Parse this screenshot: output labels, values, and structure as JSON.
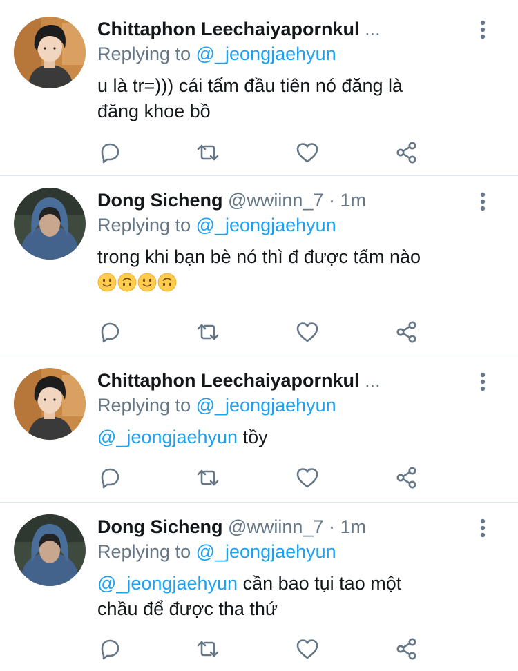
{
  "tweets": [
    {
      "display_name": "Chittaphon Leechaiyapornkul",
      "handle": "",
      "dot": "",
      "time": "",
      "ellipsis": "...",
      "reply_prefix": "Replying to ",
      "reply_to": "@_jeongjaehyun",
      "mention": "",
      "text_line1": "u là tr=))) cái tấm đầu tiên nó đăng là",
      "text_line2": "đăng khoe bồ",
      "emojis": []
    },
    {
      "display_name": "Dong Sicheng",
      "handle": "@wwiinn_7",
      "dot": "·",
      "time": "1m",
      "ellipsis": "",
      "reply_prefix": "Replying to ",
      "reply_to": "@_jeongjaehyun",
      "mention": "",
      "text_line1": "trong khi bạn bè nó thì đ được tấm nào",
      "text_line2": "",
      "emojis": [
        "slightly-smiling-face",
        "upside-down-face",
        "slightly-smiling-face",
        "upside-down-face"
      ]
    },
    {
      "display_name": "Chittaphon Leechaiyapornkul",
      "handle": "",
      "dot": "",
      "time": "",
      "ellipsis": "...",
      "reply_prefix": "Replying to ",
      "reply_to": "@_jeongjaehyun",
      "mention": "@_jeongjaehyun",
      "text_line1": " tồy",
      "text_line2": "",
      "emojis": []
    },
    {
      "display_name": "Dong Sicheng",
      "handle": "@wwiinn_7",
      "dot": "·",
      "time": "1m",
      "ellipsis": "",
      "reply_prefix": "Replying to ",
      "reply_to": "@_jeongjaehyun",
      "mention": "@_jeongjaehyun",
      "text_line1": " cần bao tụi tao một",
      "text_line2": "chầu để được tha thứ",
      "emojis": []
    }
  ],
  "icons": {
    "reply": "reply-icon",
    "retweet": "retweet-icon",
    "like": "heart-icon",
    "share": "share-icon",
    "more": "more-vertical-icon"
  },
  "colors": {
    "text": "#14171a",
    "secondary": "#657786",
    "link": "#1da1f2",
    "divider": "#e1e8ed"
  }
}
